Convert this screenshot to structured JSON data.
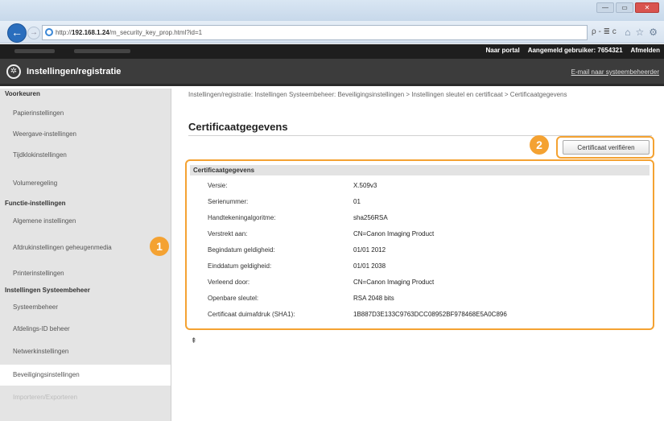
{
  "browser": {
    "url_prefix": "http://",
    "url_host": "192.168.1.24",
    "url_path": "/m_security_key_prop.html?id=1",
    "tools": "ρ - ≣ c",
    "window_controls": [
      "—",
      "▭",
      "✕"
    ],
    "browser_icons": [
      "⌂",
      "☆",
      "⚙"
    ],
    "back": "←",
    "forward": "→"
  },
  "header": {
    "links": [
      "Naar portal",
      "Aangemeld gebruiker:  7654321",
      "Afmelden"
    ],
    "app_title": "Instellingen/registratie",
    "admin_mail": "E-mail naar systeembeheerder"
  },
  "sidebar": {
    "sections": [
      {
        "title": "Voorkeuren",
        "items": [
          "Papierinstellingen",
          "Weergave-instellingen",
          "Tijdklokinstellingen",
          "Volumeregeling"
        ]
      },
      {
        "title": "Functie-instellingen",
        "items": [
          "Algemene instellingen",
          "Afdrukinstellingen geheugenmedia",
          "Printerinstellingen"
        ]
      },
      {
        "title": "Instellingen Systeembeheer",
        "items": [
          "Systeembeheer",
          "Afdelings-ID beheer",
          "Netwerkinstellingen",
          "Beveiligingsinstellingen",
          "Importeren/Exporteren"
        ]
      }
    ],
    "active_item": "Beveiligingsinstellingen"
  },
  "main": {
    "breadcrumb": "Instellingen/registratie: Instellingen Systeembeheer: Beveiligingsinstellingen > Instellingen sleutel en certificaat > Certificaatgegevens",
    "page_title": "Certificaatgegevens",
    "verify_button": "Certificaat verifiëren",
    "section_title": "Certificaatgegevens",
    "rows": [
      {
        "label": "Versie:",
        "value": "X.509v3"
      },
      {
        "label": "Serienummer:",
        "value": "01"
      },
      {
        "label": "Handtekeningalgoritme:",
        "value": "sha256RSA"
      },
      {
        "label": "Verstrekt aan:",
        "value": "CN=Canon Imaging Product"
      },
      {
        "label": "Begindatum geldigheid:",
        "value": "01/01 2012"
      },
      {
        "label": "Einddatum geldigheid:",
        "value": "01/01 2038"
      },
      {
        "label": "Verleend door:",
        "value": "CN=Canon Imaging Product"
      },
      {
        "label": "Openbare sleutel:",
        "value": "RSA 2048 bits"
      },
      {
        "label": "Certificaat duimafdruk (SHA1):",
        "value": "1B887D3E133C9763DCC08952BF978468E5A0C896"
      }
    ],
    "back_to_top": "⇞"
  },
  "callouts": {
    "badge1": "1",
    "badge2": "2"
  },
  "colors": {
    "callout": "#f4a232",
    "header_bg": "#3c3c3c",
    "sidebar_bg": "#e4e4e4"
  }
}
